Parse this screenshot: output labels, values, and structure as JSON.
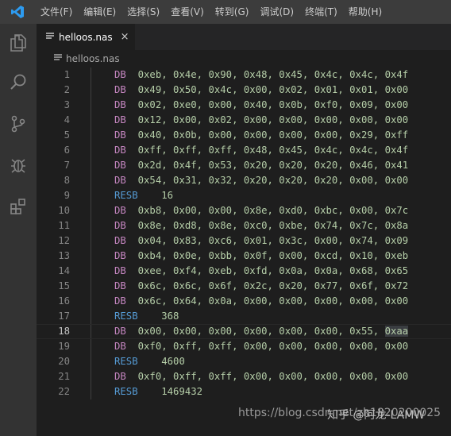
{
  "menu": {
    "items": [
      "文件(F)",
      "编辑(E)",
      "选择(S)",
      "查看(V)",
      "转到(G)",
      "调试(D)",
      "终端(T)",
      "帮助(H)"
    ]
  },
  "activity_icons": [
    "explorer-icon",
    "search-icon",
    "source-control-icon",
    "debug-icon",
    "extensions-icon"
  ],
  "tab": {
    "label": "helloos.nas",
    "close": "×"
  },
  "breadcrumb": {
    "file": "helloos.nas"
  },
  "editor": {
    "lines": [
      {
        "n": "1",
        "kw": "DB",
        "args": "0xeb, 0x4e, 0x90, 0x48, 0x45, 0x4c, 0x4c, 0x4f"
      },
      {
        "n": "2",
        "kw": "DB",
        "args": "0x49, 0x50, 0x4c, 0x00, 0x02, 0x01, 0x01, 0x00"
      },
      {
        "n": "3",
        "kw": "DB",
        "args": "0x02, 0xe0, 0x00, 0x40, 0x0b, 0xf0, 0x09, 0x00"
      },
      {
        "n": "4",
        "kw": "DB",
        "args": "0x12, 0x00, 0x02, 0x00, 0x00, 0x00, 0x00, 0x00"
      },
      {
        "n": "5",
        "kw": "DB",
        "args": "0x40, 0x0b, 0x00, 0x00, 0x00, 0x00, 0x29, 0xff"
      },
      {
        "n": "6",
        "kw": "DB",
        "args": "0xff, 0xff, 0xff, 0x48, 0x45, 0x4c, 0x4c, 0x4f"
      },
      {
        "n": "7",
        "kw": "DB",
        "args": "0x2d, 0x4f, 0x53, 0x20, 0x20, 0x20, 0x46, 0x41"
      },
      {
        "n": "8",
        "kw": "DB",
        "args": "0x54, 0x31, 0x32, 0x20, 0x20, 0x20, 0x00, 0x00"
      },
      {
        "n": "9",
        "kw": "RESB",
        "args": "16"
      },
      {
        "n": "10",
        "kw": "DB",
        "args": "0xb8, 0x00, 0x00, 0x8e, 0xd0, 0xbc, 0x00, 0x7c"
      },
      {
        "n": "11",
        "kw": "DB",
        "args": "0x8e, 0xd8, 0x8e, 0xc0, 0xbe, 0x74, 0x7c, 0x8a"
      },
      {
        "n": "12",
        "kw": "DB",
        "args": "0x04, 0x83, 0xc6, 0x01, 0x3c, 0x00, 0x74, 0x09"
      },
      {
        "n": "13",
        "kw": "DB",
        "args": "0xb4, 0x0e, 0xbb, 0x0f, 0x00, 0xcd, 0x10, 0xeb"
      },
      {
        "n": "14",
        "kw": "DB",
        "args": "0xee, 0xf4, 0xeb, 0xfd, 0x0a, 0x0a, 0x68, 0x65"
      },
      {
        "n": "15",
        "kw": "DB",
        "args": "0x6c, 0x6c, 0x6f, 0x2c, 0x20, 0x77, 0x6f, 0x72"
      },
      {
        "n": "16",
        "kw": "DB",
        "args": "0x6c, 0x64, 0x0a, 0x00, 0x00, 0x00, 0x00, 0x00"
      },
      {
        "n": "17",
        "kw": "RESB",
        "args": "368"
      },
      {
        "n": "18",
        "kw": "DB",
        "args": "0x00, 0x00, 0x00, 0x00, 0x00, 0x00, 0x55, ",
        "highlight": "0xaa"
      },
      {
        "n": "19",
        "kw": "DB",
        "args": "0xf0, 0xff, 0xff, 0x00, 0x00, 0x00, 0x00, 0x00"
      },
      {
        "n": "20",
        "kw": "RESB",
        "args": "4600"
      },
      {
        "n": "21",
        "kw": "DB",
        "args": "0xf0, 0xff, 0xff, 0x00, 0x00, 0x00, 0x00, 0x00"
      },
      {
        "n": "22",
        "kw": "RESB",
        "args": "1469432"
      }
    ],
    "current_line": "18"
  },
  "watermark": {
    "url": "https://blog.csdn.net/zh1820200025",
    "author": "知乎 @阿龙-LAMW"
  },
  "colors": {
    "keyword_db": "#c586c0",
    "keyword_resb": "#569cd6",
    "number": "#b5cea8",
    "background": "#1e1e1e"
  }
}
